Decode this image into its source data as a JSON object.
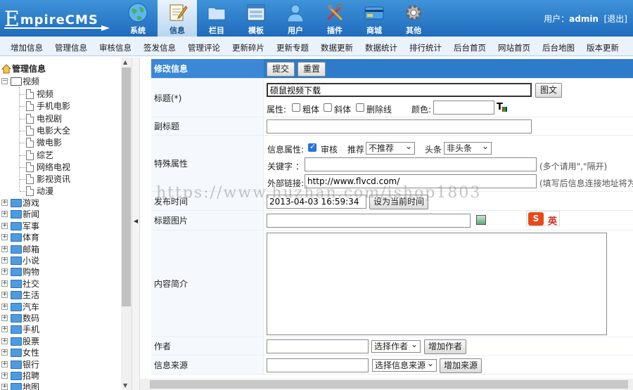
{
  "header": {
    "logo_first": "E",
    "logo_rest": "mpireCMS",
    "nav": [
      {
        "label": "系统",
        "icon": "globe-icon"
      },
      {
        "label": "信息",
        "icon": "edit-document-icon"
      },
      {
        "label": "栏目",
        "icon": "folder-icon"
      },
      {
        "label": "模板",
        "icon": "template-window-icon"
      },
      {
        "label": "用户",
        "icon": "user-icon"
      },
      {
        "label": "插件",
        "icon": "tools-icon"
      },
      {
        "label": "商城",
        "icon": "credit-card-icon"
      },
      {
        "label": "其他",
        "icon": "gear-icon"
      }
    ],
    "active_nav": "信息",
    "user_label": "用户：",
    "user_name": "admin",
    "logout": "[退出]"
  },
  "submenu": [
    "增加信息",
    "管理信息",
    "审核信息",
    "签发信息",
    "管理评论",
    "更新碎片",
    "更新专题",
    "数据更新",
    "数据统计",
    "排行统计",
    "后台首页",
    "网站首页",
    "后台地图",
    "版本更新"
  ],
  "tree": {
    "root": "管理信息",
    "open_node": "视频",
    "open_children": [
      "视频",
      "手机电影",
      "电视剧",
      "电影大全",
      "微电影",
      "综艺",
      "网络电视",
      "影视资讯",
      "动漫"
    ],
    "closed_nodes": [
      "游戏",
      "新闻",
      "军事",
      "体育",
      "邮箱",
      "小说",
      "购物",
      "社交",
      "生活",
      "汽车",
      "数码",
      "手机",
      "股票",
      "女性",
      "银行",
      "招聘",
      "地图"
    ]
  },
  "form": {
    "header_label": "修改信息",
    "submit": "提交",
    "reset": "重置",
    "title_label": "标题(*)",
    "title_value": "硕鼠视频下载",
    "title_image_btn": "图文",
    "attr_label": "属性:",
    "bold": "粗体",
    "italic": "斜体",
    "strike": "删除线",
    "color_label": "颜色:",
    "subtitle_label": "副标题",
    "special_label": "特殊属性",
    "info_attr_label": "信息属性:",
    "check_label": "审核",
    "recommend_label": "推荐",
    "recommend_value": "不推荐",
    "headline_label": "头条",
    "headline_value": "非头条",
    "keyword_label": "关键字 ：",
    "keyword_hint": "(多个请用\",\"隔开)",
    "extlink_label": "外部链接:",
    "extlink_value": "http://www.flvcd.com/",
    "extlink_hint": "(填写后信息连接地址将为",
    "pubtime_label": "发布时间",
    "pubtime_value": "2013-04-03 16:59:34",
    "set_now_btn": "设为当前时间",
    "titlepic_label": "标题图片",
    "intro_label": "内容简介",
    "author_label": "作者",
    "author_select": "选择作者",
    "add_author_btn": "增加作者",
    "source_label": "信息来源",
    "source_select": "选择信息来源",
    "add_source_btn": "增加来源"
  },
  "watermark": "https://www.huzhan.com/ishop1803",
  "ime_badge": "英"
}
